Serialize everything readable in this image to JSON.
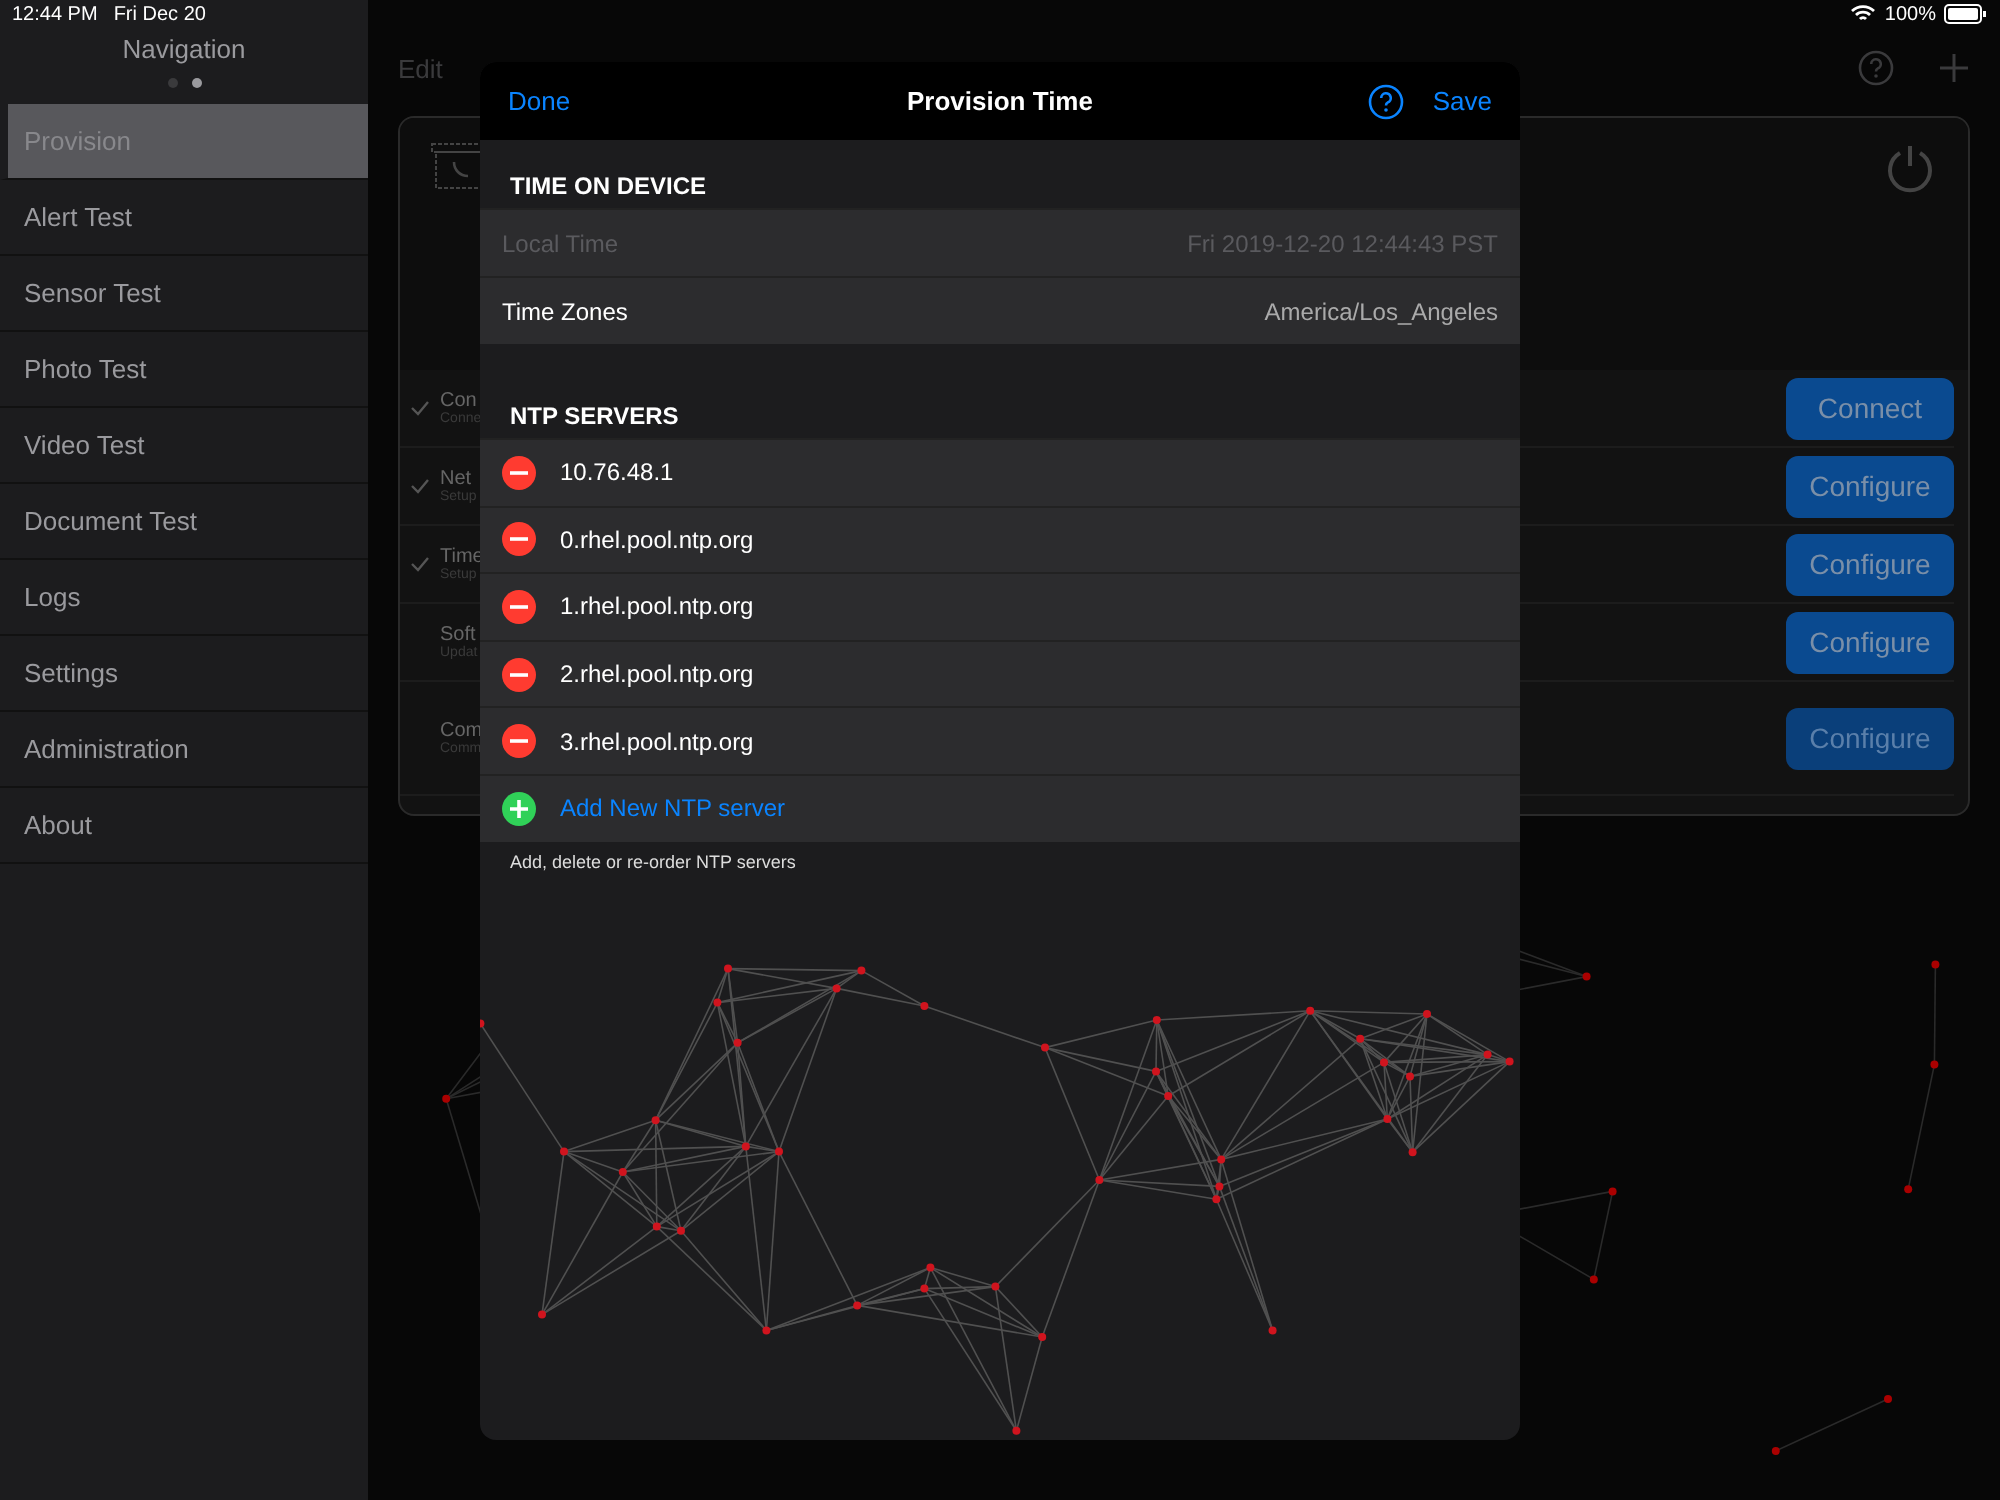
{
  "status_bar": {
    "time": "12:44 PM",
    "date": "Fri Dec 20",
    "battery": "100%"
  },
  "sidebar": {
    "title": "Navigation",
    "pages": [
      {
        "selected": false
      },
      {
        "selected": true
      }
    ],
    "items": [
      {
        "label": "Provision",
        "selected": true
      },
      {
        "label": "Alert Test",
        "selected": false
      },
      {
        "label": "Sensor Test",
        "selected": false
      },
      {
        "label": "Photo Test",
        "selected": false
      },
      {
        "label": "Video Test",
        "selected": false
      },
      {
        "label": "Document Test",
        "selected": false
      },
      {
        "label": "Logs",
        "selected": false
      },
      {
        "label": "Settings",
        "selected": false
      },
      {
        "label": "Administration",
        "selected": false
      },
      {
        "label": "About",
        "selected": false
      }
    ]
  },
  "toolbar": {
    "edit": "Edit"
  },
  "steps": [
    {
      "title": "Con",
      "subtitle": "Conne",
      "checked": true,
      "button": "Connect",
      "disabled": false
    },
    {
      "title": "Net",
      "subtitle": "Setup",
      "checked": true,
      "button": "Configure",
      "disabled": false
    },
    {
      "title": "Time",
      "subtitle": "Setup",
      "checked": true,
      "button": "Configure",
      "disabled": false
    },
    {
      "title": "Soft",
      "subtitle": "Updat",
      "checked": false,
      "button": "Configure",
      "disabled": false
    },
    {
      "title": "Com",
      "subtitle": "Comm",
      "checked": false,
      "button": "Configure",
      "disabled": true
    }
  ],
  "modal": {
    "title": "Provision Time",
    "done": "Done",
    "save": "Save",
    "time_section": {
      "header": "TIME ON DEVICE",
      "rows": [
        {
          "label": "Local Time",
          "value": "Fri 2019-12-20 12:44:43 PST",
          "disabled": true
        },
        {
          "label": "Time Zones",
          "value": "America/Los_Angeles",
          "disabled": false
        }
      ]
    },
    "ntp_section": {
      "header": "NTP SERVERS",
      "servers": [
        "10.76.48.1",
        "0.rhel.pool.ntp.org",
        "1.rhel.pool.ntp.org",
        "2.rhel.pool.ntp.org",
        "3.rhel.pool.ntp.org"
      ],
      "add": "Add New NTP server",
      "footer": "Add, delete or re-order NTP servers"
    }
  }
}
